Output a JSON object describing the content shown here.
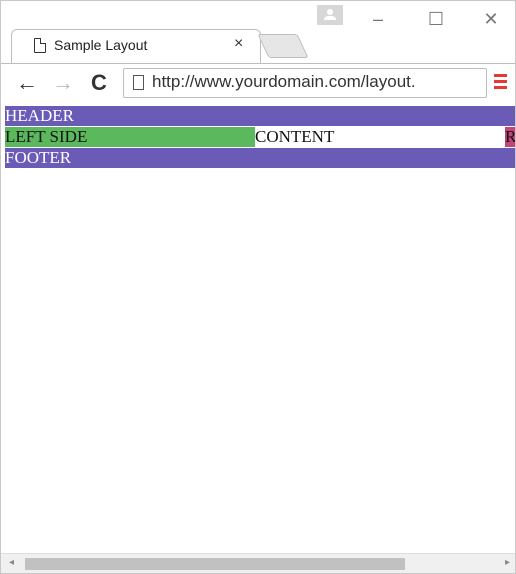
{
  "browser": {
    "tab_title": "Sample Layout",
    "tab_close": "×",
    "minimize_symbol": "–",
    "maximize_symbol": "☐",
    "close_symbol": "✕",
    "back_symbol": "←",
    "forward_symbol": "→",
    "reload_symbol": "C",
    "url": "http://www.yourdomain.com/layout.",
    "menu_color": "#e53935"
  },
  "page": {
    "header_text": "HEADER",
    "left_text": "LEFT SIDE",
    "content_text": "CONTENT",
    "right_text": "R",
    "footer_text": "FOOTER",
    "colors": {
      "header_footer": "#6a5bb7",
      "left": "#5cb85c",
      "content": "#ffffff",
      "right": "#c2447a"
    }
  },
  "scrollbar": {
    "left_arrow": "◂",
    "right_arrow": "▸"
  }
}
